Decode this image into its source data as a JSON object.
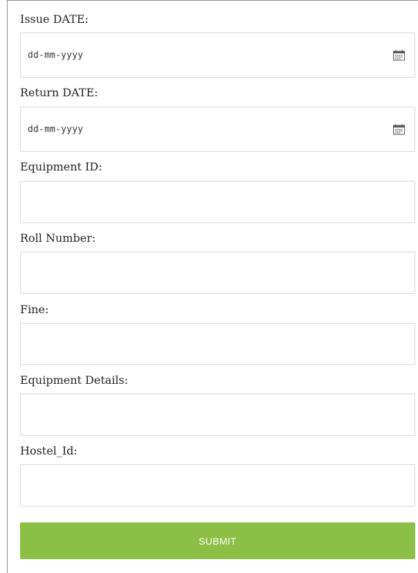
{
  "form": {
    "issue_date": {
      "label": "Issue DATE:",
      "placeholder": "dd-mm-yyyy",
      "icon": "calendar-icon"
    },
    "return_date": {
      "label": "Return DATE:",
      "placeholder": "dd-mm-yyyy",
      "icon": "calendar-icon"
    },
    "equipment_id": {
      "label": "Equipment ID:",
      "value": ""
    },
    "roll_number": {
      "label": "Roll Number:",
      "value": ""
    },
    "fine": {
      "label": "Fine:",
      "value": ""
    },
    "equipment_details": {
      "label": "Equipment Details:",
      "value": ""
    },
    "hostel_id": {
      "label": "Hostel_Id:",
      "value": ""
    },
    "submit_label": "SUBMIT"
  },
  "colors": {
    "submit_bg": "#8bbf45",
    "submit_text": "#ffffff",
    "input_border": "#d6d6d6"
  }
}
